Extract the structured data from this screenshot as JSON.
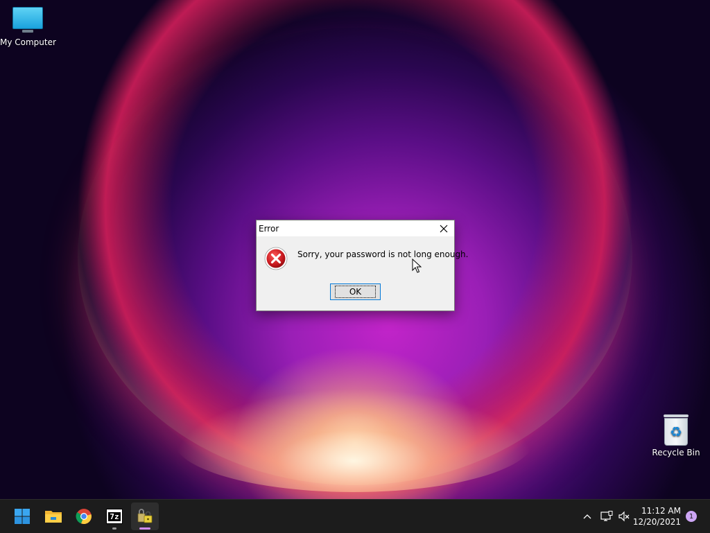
{
  "desktop": {
    "icons": [
      {
        "label": "My Computer",
        "icon": "computer-icon"
      },
      {
        "label": "Recycle Bin",
        "icon": "recycle-bin-icon"
      }
    ]
  },
  "dialog": {
    "title": "Error",
    "message": "Sorry, your password is not long enough.",
    "ok_label": "OK",
    "icon": "error-icon",
    "close_icon": "close-icon"
  },
  "taskbar": {
    "apps": [
      {
        "name": "Start",
        "icon": "windows-start-icon",
        "active": false
      },
      {
        "name": "File Explorer",
        "icon": "folder-icon",
        "active": false
      },
      {
        "name": "Google Chrome",
        "icon": "chrome-icon",
        "active": false
      },
      {
        "name": "7-Zip",
        "icon": "7zip-icon",
        "label": "7z",
        "active": false
      },
      {
        "name": "Password Utility",
        "icon": "lock-app-icon",
        "active": true
      }
    ],
    "tray": {
      "overflow_icon": "chevron-up-icon",
      "network_icon": "network-icon",
      "volume_icon": "volume-muted-icon"
    },
    "clock": {
      "time": "11:12 AM",
      "date": "12/20/2021"
    },
    "notification_count": "1"
  },
  "colors": {
    "accent": "#0078d7",
    "taskbar_bg": "#1c1c1c",
    "error_red": "#c4161c"
  }
}
